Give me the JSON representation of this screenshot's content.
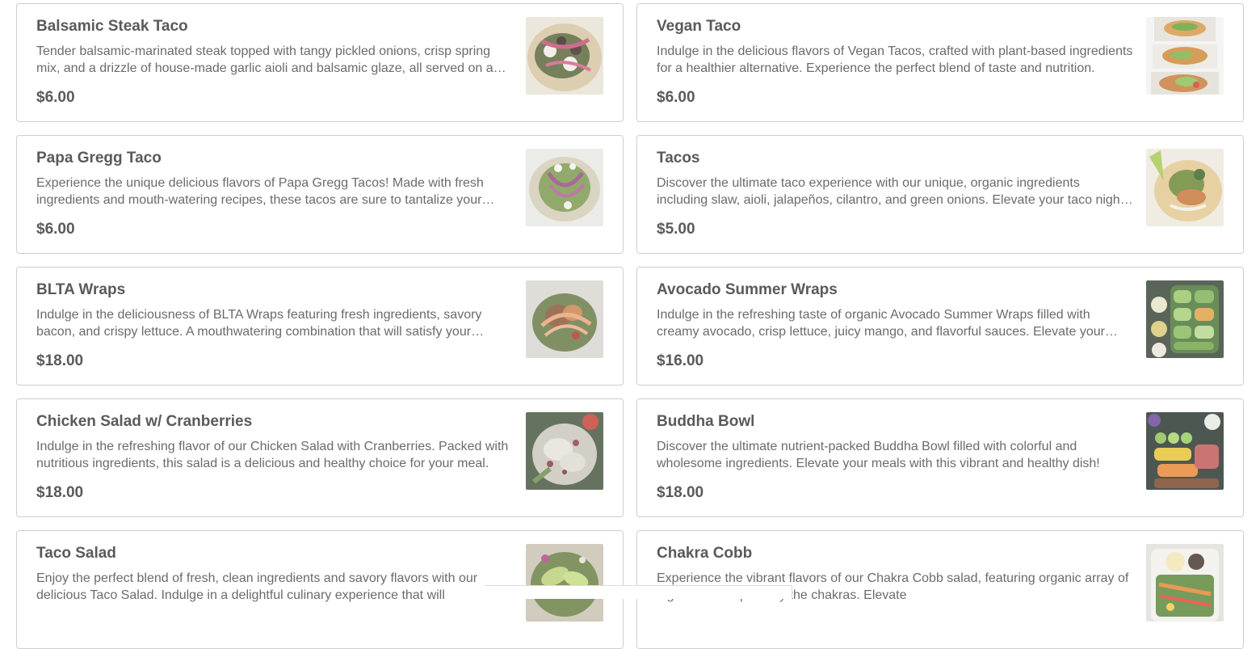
{
  "menu_items": [
    {
      "name": "Balsamic Steak Taco",
      "description": "Tender balsamic-marinated steak topped with tangy pickled onions, crisp spring mix, and a drizzle of house-made garlic aioli and balsamic glaze, all served on a warm tortilla.",
      "price": "$6.00",
      "image_icon": "steak-taco-photo"
    },
    {
      "name": "Vegan Taco",
      "description": "Indulge in the delicious flavors of Vegan Tacos, crafted with plant-based ingredients for a healthier alternative. Experience the perfect blend of taste and nutrition.",
      "price": "$6.00",
      "image_icon": "vegan-taco-photo"
    },
    {
      "name": "Papa Gregg Taco",
      "description": "Experience the unique delicious flavors of Papa Gregg Tacos! Made with fresh ingredients and mouth-watering recipes, these tacos are sure to tantalize your taste buds.",
      "price": "$6.00",
      "image_icon": "papa-gregg-taco-photo"
    },
    {
      "name": "Tacos",
      "description": "Discover the ultimate taco experience with our unique, organic ingredients including slaw, aioli, jalapeños, cilantro, and green onions. Elevate your taco night today.",
      "price": "$5.00",
      "image_icon": "tacos-photo"
    },
    {
      "name": "BLTA Wraps",
      "description": "Indulge in the deliciousness of BLTA Wraps featuring fresh ingredients, savory bacon, and crispy lettuce. A mouthwatering combination that will satisfy your cravings.",
      "price": "$18.00",
      "image_icon": "blta-wrap-photo"
    },
    {
      "name": "Avocado Summer Wraps",
      "description": "Indulge in the refreshing taste of organic Avocado Summer Wraps filled with creamy avocado, crisp lettuce, juicy mango, and flavorful sauces. Elevate your lunch today.",
      "price": "$16.00",
      "image_icon": "summer-wraps-photo"
    },
    {
      "name": "Chicken Salad w/ Cranberries",
      "description": "Indulge in the refreshing flavor of our Chicken Salad with Cranberries. Packed with nutritious ingredients, this salad is a delicious and healthy choice for your meal.",
      "price": "$18.00",
      "image_icon": "chicken-salad-photo"
    },
    {
      "name": "Buddha Bowl",
      "description": "Discover the ultimate nutrient-packed Buddha Bowl filled with colorful and wholesome ingredients. Elevate your meals with this vibrant and healthy dish!",
      "price": "$18.00",
      "image_icon": "buddha-bowl-photo"
    },
    {
      "name": "Taco Salad",
      "description": "Enjoy the perfect blend of fresh, clean ingredients and savory flavors with our delicious Taco Salad. Indulge in a delightful culinary experience that will",
      "price": "",
      "image_icon": "taco-salad-photo"
    },
    {
      "name": "Chakra Cobb",
      "description": "Experience the vibrant flavors of our Chakra Cobb salad, featuring organic array of ingredients inspired by the chakras. Elevate",
      "price": "",
      "image_icon": "chakra-cobb-photo"
    }
  ]
}
